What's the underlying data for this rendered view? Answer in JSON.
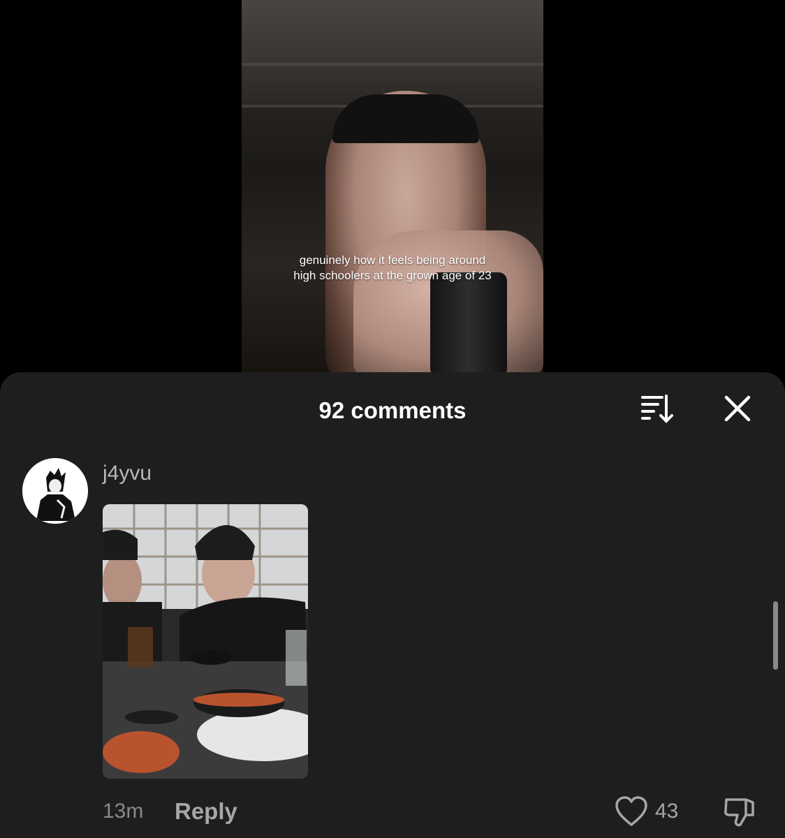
{
  "video": {
    "caption_line1": "genuinely how it feels being around",
    "caption_line2": "high schoolers at the grown age of 23"
  },
  "comments_sheet": {
    "title": "92 comments",
    "sort_icon": "sort-icon",
    "close_icon": "close-icon"
  },
  "comment": {
    "username": "j4yvu",
    "avatar_icon": "avatar",
    "time": "13m",
    "reply_label": "Reply",
    "likes": "43",
    "like_icon": "heart-icon",
    "dislike_icon": "thumbs-down-icon"
  },
  "colors": {
    "sheet_background": "#1e1e1e",
    "text_primary": "#ffffff",
    "text_secondary": "#a6a6a6"
  }
}
